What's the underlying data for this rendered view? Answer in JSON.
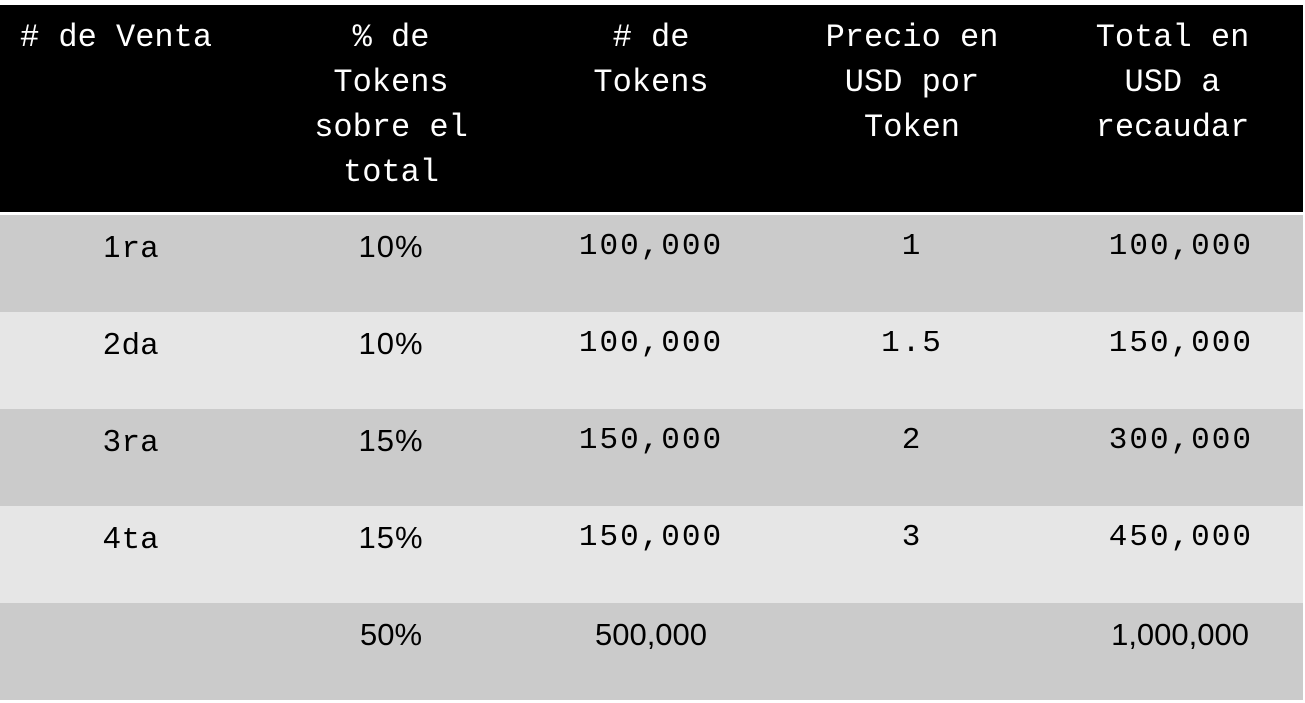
{
  "table": {
    "headers": [
      "# de Venta",
      "% de\nTokens\nsobre el\ntotal",
      "# de\nTokens",
      "Precio en\nUSD por\nToken",
      "Total en\nUSD a\nrecaudar"
    ],
    "rows": [
      {
        "venta_num": "1",
        "venta_suf": "ra",
        "pct": "10%",
        "tokens": "100,000",
        "precio": "1",
        "total": "100,000"
      },
      {
        "venta_num": "2",
        "venta_suf": "da",
        "pct": "10%",
        "tokens": "100,000",
        "precio": "1.5",
        "total": "150,000"
      },
      {
        "venta_num": "3",
        "venta_suf": "ra",
        "pct": "15%",
        "tokens": "150,000",
        "precio": "2",
        "total": "300,000"
      },
      {
        "venta_num": "4",
        "venta_suf": "ta",
        "pct": "15%",
        "tokens": "150,000",
        "precio": "3",
        "total": "450,000"
      }
    ],
    "totals": {
      "venta": "",
      "pct": "50%",
      "tokens": "500,000",
      "precio": "",
      "total": "1,000,000"
    }
  },
  "colors": {
    "header_bg": "#000000",
    "header_text": "#ffffff",
    "row_dark": "#cbcbcb",
    "row_light": "#e6e6e6"
  }
}
